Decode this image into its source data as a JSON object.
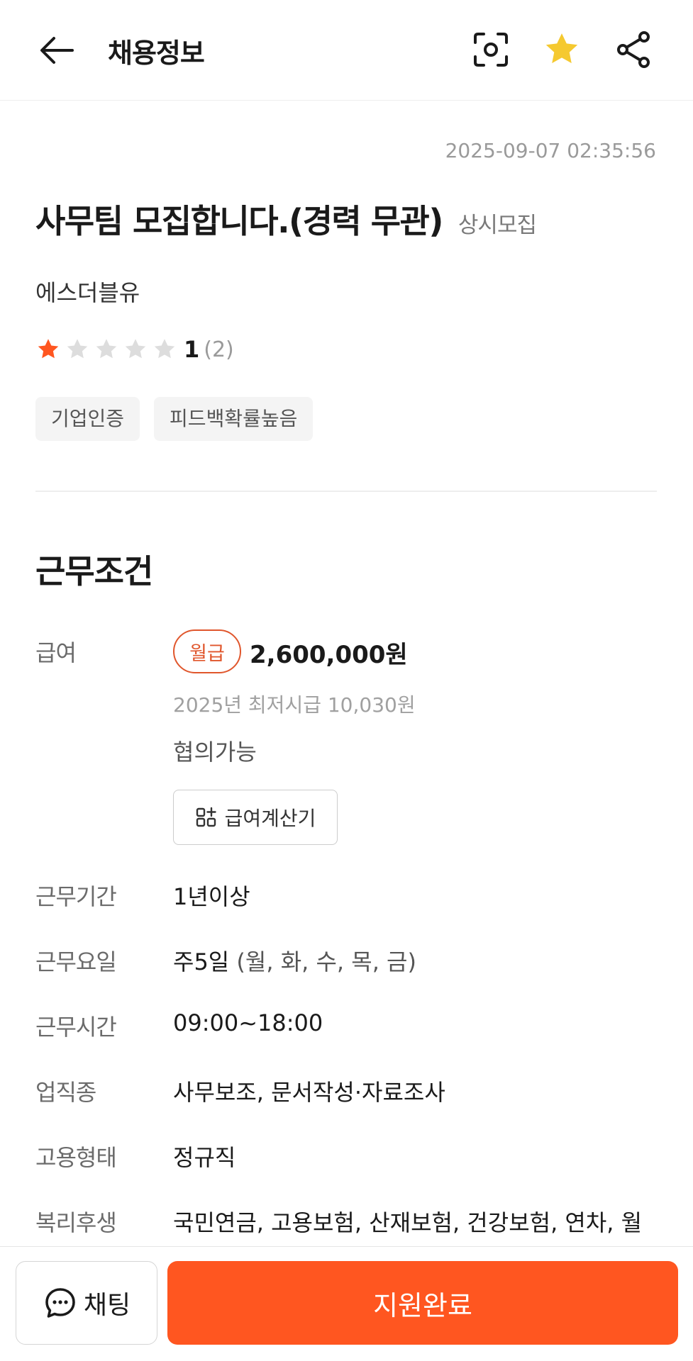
{
  "header": {
    "title": "채용정보",
    "icons": [
      "back-arrow-icon",
      "scan-icon",
      "star-icon",
      "share-icon"
    ],
    "favorite_color": "#f5c930"
  },
  "posting": {
    "timestamp": "2025-09-07 02:35:56",
    "title": "사무팀 모집합니다.(경력 무관)",
    "status": "상시모집",
    "company": "에스더블유",
    "rating": {
      "stars_filled": 1,
      "stars_total": 5,
      "value": "1",
      "count": "(2)",
      "star_color": "#ff5620"
    },
    "tags": [
      "기업인증",
      "피드백확률높음"
    ]
  },
  "conditions": {
    "section_title": "근무조건",
    "pay": {
      "label": "급여",
      "type": "월급",
      "amount": "2,600,000원",
      "min_wage_note": "2025년 최저시급 10,030원",
      "negotiable": "협의가능",
      "calc_button": "급여계산기"
    },
    "period": {
      "label": "근무기간",
      "value": "1년이상"
    },
    "days": {
      "label": "근무요일",
      "value": "주5일",
      "detail": "(월, 화, 수, 목, 금)"
    },
    "hours": {
      "label": "근무시간",
      "value": "09:00~18:00"
    },
    "job_type": {
      "label": "업직종",
      "value": "사무보조, 문서작성·자료조사"
    },
    "employment": {
      "label": "고용형태",
      "value": "정규직"
    },
    "welfare": {
      "label": "복리후생",
      "value": "국민연금, 고용보험, 산재보험, 건강보험, 연차, 월차, 정기휴가, 주식 제공, 퇴직금, 주식 지급"
    }
  },
  "bottom": {
    "chat_label": "채팅",
    "apply_label": "지원완료",
    "apply_color": "#ff5620"
  }
}
